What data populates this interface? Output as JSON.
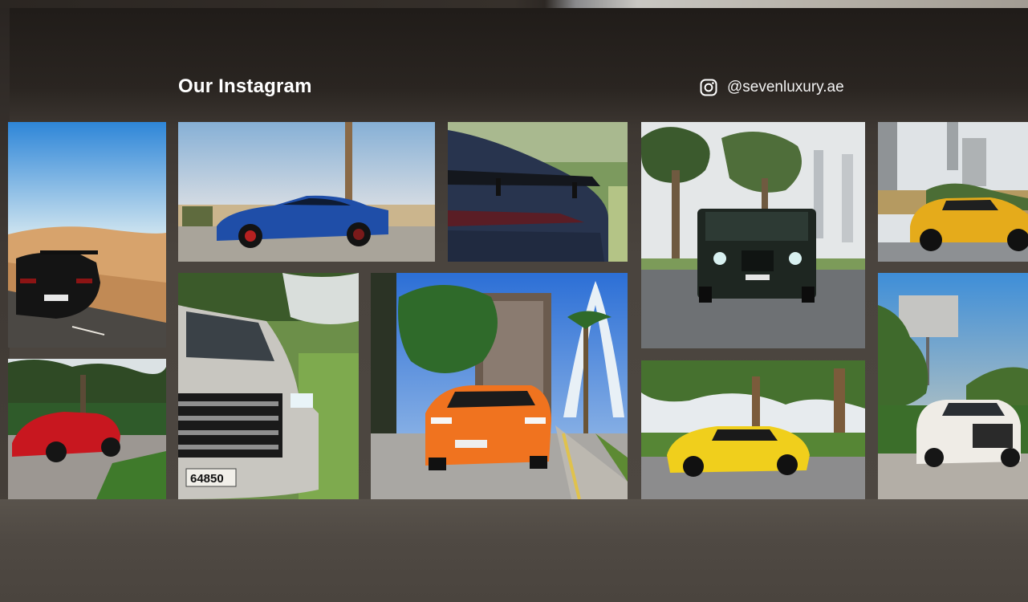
{
  "section": {
    "title": "Our Instagram",
    "instagram_handle": "@sevenluxury.ae"
  },
  "icons": {
    "instagram": "instagram-icon"
  },
  "photos": [
    {
      "name": "black-supercar-desert-road",
      "car_color": "#151515"
    },
    {
      "name": "blue-bentley-coupe-beach",
      "car_color": "#1e44a0"
    },
    {
      "name": "mercedes-amg-gt-rear-wing",
      "car_color": "#27324a"
    },
    {
      "name": "black-mercedes-g-class-palms",
      "car_color": "#1d2420"
    },
    {
      "name": "yellow-lamborghini-urus-city",
      "car_color": "#e3a51a"
    },
    {
      "name": "red-ferrari-f8-spider-park",
      "car_color": "#c91a22"
    },
    {
      "name": "silver-cadillac-escalade-front",
      "car_color": "#c8c7c2",
      "plate": "64850"
    },
    {
      "name": "orange-lamborghini-urus-dubai",
      "car_color": "#f0731f"
    },
    {
      "name": "yellow-ferrari-488-pista-trees",
      "car_color": "#f0cf1c"
    },
    {
      "name": "white-cadillac-escalade-street",
      "car_color": "#efece6"
    }
  ]
}
